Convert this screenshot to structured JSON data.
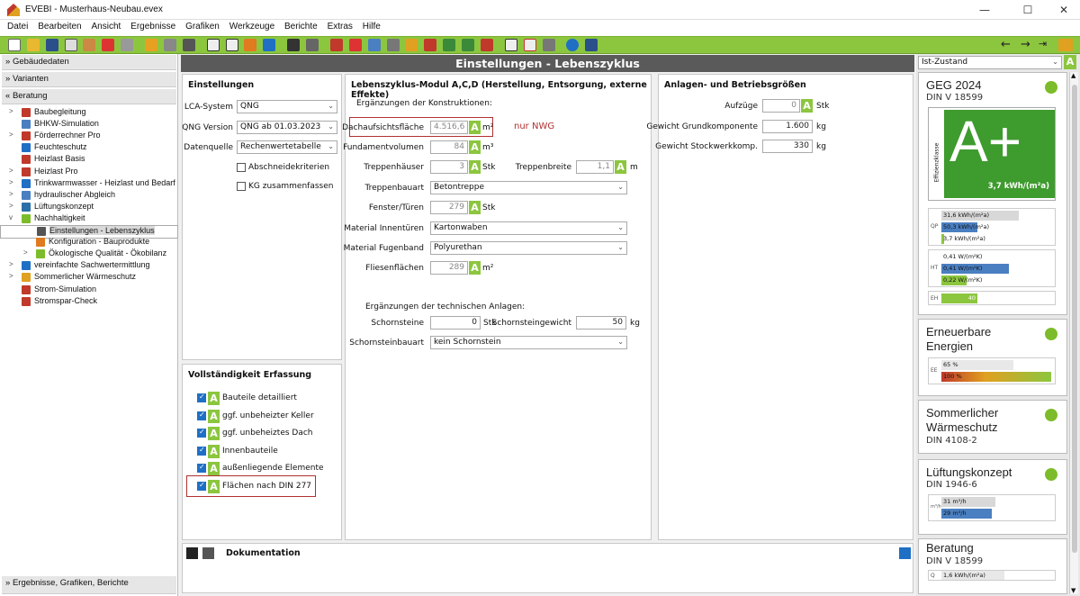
{
  "window": {
    "title": "EVEBI - Musterhaus-Neubau.evex",
    "min": "—",
    "max": "☐",
    "close": "✕"
  },
  "menu": [
    "Datei",
    "Bearbeiten",
    "Ansicht",
    "Ergebnisse",
    "Grafiken",
    "Werkzeuge",
    "Berichte",
    "Extras",
    "Hilfe"
  ],
  "left": {
    "sections": [
      "Gebäudedaten",
      "Varianten",
      "Beratung"
    ],
    "tree": [
      {
        "label": "Baubegleitung",
        "exp": ">",
        "indent": 0,
        "color": "#c0392b"
      },
      {
        "label": "BHKW-Simulation",
        "exp": "",
        "indent": 0,
        "color": "#4a7fc1"
      },
      {
        "label": "Förderrechner Pro",
        "exp": ">",
        "indent": 0,
        "color": "#c0392b"
      },
      {
        "label": "Feuchteschutz",
        "exp": "",
        "indent": 0,
        "color": "#1f6fc5"
      },
      {
        "label": "Heizlast Basis",
        "exp": "",
        "indent": 0,
        "color": "#c0392b"
      },
      {
        "label": "Heizlast Pro",
        "exp": ">",
        "indent": 0,
        "color": "#c0392b"
      },
      {
        "label": "Trinkwarmwasser - Heizlast und Bedarf",
        "exp": ">",
        "indent": 0,
        "color": "#1f6fc5"
      },
      {
        "label": "hydraulischer Abgleich",
        "exp": ">",
        "indent": 0,
        "color": "#4a7fc1"
      },
      {
        "label": "Lüftungskonzept",
        "exp": ">",
        "indent": 0,
        "color": "#2a6fa8"
      },
      {
        "label": "Nachhaltigkeit",
        "exp": "v",
        "indent": 0,
        "color": "#7cbc2a"
      },
      {
        "label": "Einstellungen - Lebenszyklus",
        "exp": "",
        "indent": 1,
        "color": "#555",
        "selected": true
      },
      {
        "label": "Konfiguration - Bauprodukte",
        "exp": "",
        "indent": 1,
        "color": "#e07b20"
      },
      {
        "label": "Ökologische Qualität - Ökobilanz",
        "exp": ">",
        "indent": 1,
        "color": "#7cbc2a"
      },
      {
        "label": "vereinfachte Sachwertermittlung",
        "exp": ">",
        "indent": 0,
        "color": "#1f6fc5"
      },
      {
        "label": "Sommerlicher Wärmeschutz",
        "exp": ">",
        "indent": 0,
        "color": "#e0a020"
      },
      {
        "label": "Strom-Simulation",
        "exp": "",
        "indent": 0,
        "color": "#c0392b"
      },
      {
        "label": "Stromspar-Check",
        "exp": "",
        "indent": 0,
        "color": "#c0392b"
      }
    ],
    "footer": "Ergebnisse, Grafiken, Berichte"
  },
  "main": {
    "title": "Einstellungen - Lebenszyklus",
    "einstellungen": {
      "title": "Einstellungen",
      "lca_label": "LCA-System",
      "lca_value": "QNG",
      "qng_label": "QNG Version",
      "qng_value": "QNG ab 01.03.2023",
      "daten_label": "Datenquelle",
      "daten_value": "Rechenwertetabelle",
      "cb1": "Abschneidekriterien",
      "cb2": "KG zusammenfassen"
    },
    "vollst": {
      "title": "Vollständigkeit Erfassung",
      "items": [
        "Bauteile detailliert",
        "ggf. unbeheizter Keller",
        "ggf. unbeheiztes Dach",
        "Innenbauteile",
        "außenliegende Elemente",
        "Flächen nach DIN 277"
      ]
    },
    "modul": {
      "title": "Lebenszyklus-Modul A,C,D (Herstellung, Entsorgung, externe Effekte)",
      "sub1": "Ergänzungen der Konstruktionen:",
      "dach_label": "Dachaufsichtsfläche",
      "dach_value": "4.516,6",
      "dach_unit": "m²",
      "dach_note": "nur NWG",
      "fund_label": "Fundamentvolumen",
      "fund_value": "84",
      "fund_unit": "m³",
      "trepp_label": "Treppenhäuser",
      "trepp_value": "3",
      "trepp_unit": "Stk",
      "breite_label": "Treppenbreite",
      "breite_value": "1,1",
      "breite_unit": "m",
      "bauart_label": "Treppenbauart",
      "bauart_value": "Betontreppe",
      "fenster_label": "Fenster/Türen",
      "fenster_value": "279",
      "fenster_unit": "Stk",
      "innen_label": "Material Innentüren",
      "innen_value": "Kartonwaben",
      "fugen_label": "Material Fugenband",
      "fugen_value": "Polyurethan",
      "fliesen_label": "Fliesenflächen",
      "fliesen_value": "289",
      "fliesen_unit": "m²",
      "sub2": "Ergänzungen der technischen Anlagen:",
      "schorn_label": "Schornsteine",
      "schorn_value": "0",
      "schorn_unit": "Stk",
      "sgew_label": "Schornsteingewicht",
      "sgew_value": "50",
      "sgew_unit": "kg",
      "sbau_label": "Schornsteinbauart",
      "sbau_value": "kein Schornstein"
    },
    "anlagen": {
      "title": "Anlagen- und Betriebsgrößen",
      "auf_label": "Aufzüge",
      "auf_value": "0",
      "auf_unit": "Stk",
      "gk_label": "Gewicht Grundkomponente",
      "gk_value": "1.600",
      "gk_unit": "kg",
      "sw_label": "Gewicht Stockwerkkomp.",
      "sw_value": "330",
      "sw_unit": "kg"
    },
    "doku": {
      "title": "Dokumentation"
    },
    "a": "A"
  },
  "right": {
    "zustand": "Ist-Zustand",
    "geg": {
      "title": "GEG 2024",
      "sub": "DIN V 18599",
      "grade": "A+",
      "value": "3,7 kWh/(m²a)",
      "side": "Effizienzklasse",
      "qp": {
        "label": "QP",
        "bars": [
          "31,6 kWh/(m²a)",
          "50,3 kWh/(m²a)",
          "3,7 kWh/(m²a)"
        ]
      },
      "ht": {
        "label": "HT",
        "bars": [
          "0,41 W/(m²K)",
          "0,41 W/(m²K)",
          "0,22 W/(m²K)"
        ]
      },
      "eh": {
        "label": "EH",
        "value": "40"
      }
    },
    "ee": {
      "title": "Erneuerbare Energien",
      "l": "EE",
      "bars": [
        "65 %",
        "100 %"
      ]
    },
    "sw": {
      "title": "Sommerlicher Wärmeschutz",
      "sub": "DIN 4108-2"
    },
    "lk": {
      "title": "Lüftungskonzept",
      "sub": "DIN 1946-6",
      "l": "m³/h",
      "bars": [
        "31 m³/h",
        "29 m³/h"
      ]
    },
    "ber": {
      "title": "Beratung",
      "sub": "DIN V 18599",
      "l": "Q",
      "bar": "1,6 kWh/(m²a)"
    },
    "colors": {
      "green": "#8cc63f",
      "blue": "#4a7fc1",
      "accent": "#7cbc2a"
    }
  }
}
